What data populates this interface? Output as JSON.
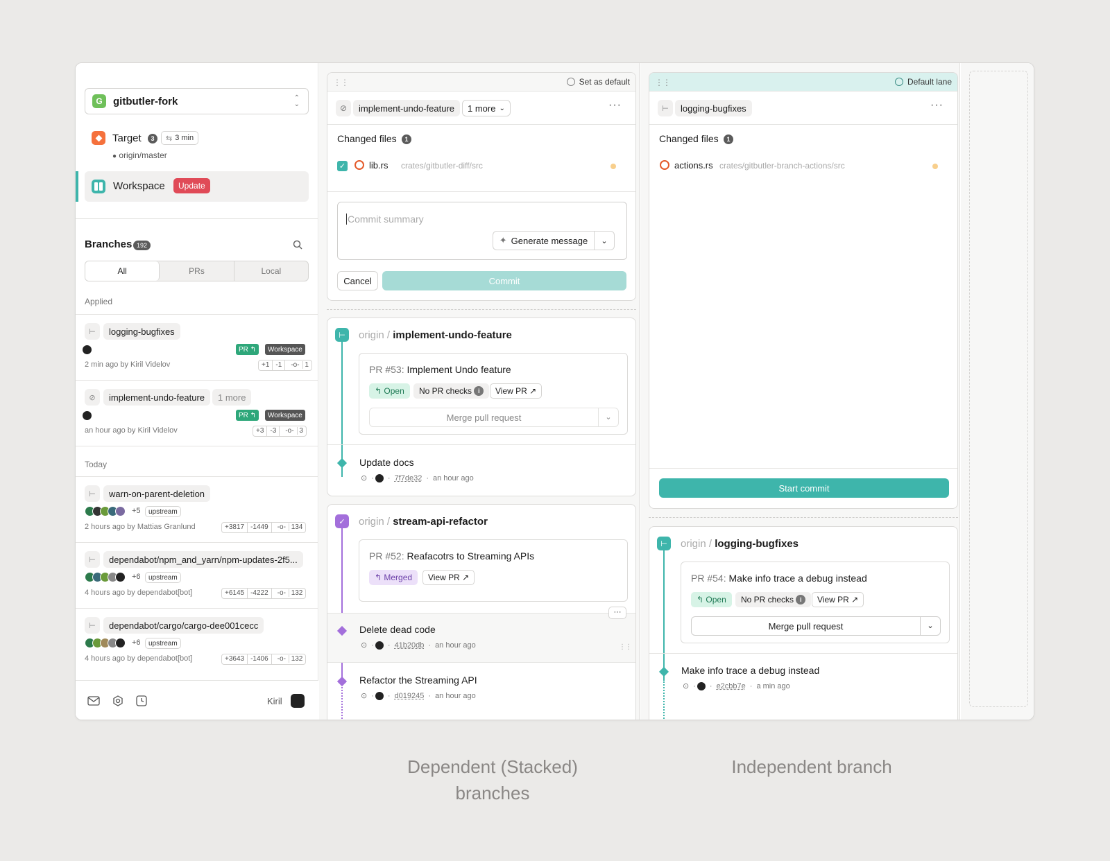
{
  "sidebar": {
    "project": {
      "initial": "G",
      "name": "gitbutler-fork"
    },
    "target": {
      "label": "Target",
      "count": "3",
      "sync_time": "3 min",
      "remote": "origin/master"
    },
    "workspace": {
      "label": "Workspace",
      "update_label": "Update"
    },
    "branches": {
      "title": "Branches",
      "count": "192",
      "tabs": [
        "All",
        "PRs",
        "Local"
      ],
      "active_tab": "All",
      "applied_label": "Applied",
      "today_label": "Today",
      "applied": [
        {
          "name": "logging-bugfixes",
          "pr": "PR",
          "workspace": "Workspace",
          "time": "2 min ago by Kiril Videlov",
          "add": "+1",
          "del": "-1",
          "commits": "1"
        },
        {
          "name": "implement-undo-feature",
          "more": "1 more",
          "pr": "PR",
          "workspace": "Workspace",
          "time": "an hour ago by Kiril Videlov",
          "add": "+3",
          "del": "-3",
          "commits": "3"
        }
      ],
      "today": [
        {
          "name": "warn-on-parent-deletion",
          "extra": "+5",
          "upstream": "upstream",
          "time": "2 hours ago by Mattias Granlund",
          "add": "+3817",
          "del": "-1449",
          "commits": "134"
        },
        {
          "name": "dependabot/npm_and_yarn/npm-updates-2f5...",
          "extra": "+6",
          "upstream": "upstream",
          "time": "4 hours ago by dependabot[bot]",
          "add": "+6145",
          "del": "-4222",
          "commits": "132"
        },
        {
          "name": "dependabot/cargo/cargo-dee001cecc",
          "extra": "+6",
          "upstream": "upstream",
          "time": "4 hours ago by dependabot[bot]",
          "add": "+3643",
          "del": "-1406",
          "commits": "132"
        }
      ]
    },
    "footer": {
      "user": "Kiril",
      "icons": [
        "mail-icon",
        "settings-icon",
        "history-icon"
      ]
    }
  },
  "lane1": {
    "set_default": "Set as default",
    "branch": "implement-undo-feature",
    "more": "1 more",
    "changed_files": "Changed files",
    "changed_count": "1",
    "file": {
      "name": "lib.rs",
      "path": "crates/gitbutler-diff/src"
    },
    "commit_placeholder": "Commit summary",
    "generate": "Generate message",
    "cancel": "Cancel",
    "commit": "Commit",
    "stack": [
      {
        "remote": "origin /",
        "name": "implement-undo-feature",
        "pr_num": "PR #53:",
        "pr_title": "Implement Undo feature",
        "status": "Open",
        "checks": "No PR checks",
        "view": "View PR",
        "merge": "Merge pull request",
        "commits": [
          {
            "title": "Update docs",
            "hash": "7f7de32",
            "time": "an hour ago"
          }
        ]
      },
      {
        "remote": "origin /",
        "name": "stream-api-refactor",
        "pr_num": "PR #52:",
        "pr_title": "Reafacotrs to Streaming APIs",
        "status": "Merged",
        "view": "View PR",
        "commits": [
          {
            "title": "Delete dead code",
            "hash": "41b20db",
            "time": "an hour ago"
          },
          {
            "title": "Refactor the Streaming API",
            "hash": "d019245",
            "time": "an hour ago"
          }
        ]
      }
    ]
  },
  "lane2": {
    "default_lane": "Default lane",
    "branch": "logging-bugfixes",
    "changed_files": "Changed files",
    "changed_count": "1",
    "file": {
      "name": "actions.rs",
      "path": "crates/gitbutler-branch-actions/src"
    },
    "start_commit": "Start commit",
    "remote": "origin /",
    "name": "logging-bugfixes",
    "pr_num": "PR #54:",
    "pr_title": "Make info trace a debug instead",
    "status": "Open",
    "checks": "No PR checks",
    "view": "View PR",
    "merge": "Merge pull request",
    "commit": {
      "title": "Make info trace a debug instead",
      "hash": "e2cbb7e",
      "time": "a min ago"
    }
  },
  "captions": {
    "stacked": [
      "Dependent (Stacked)",
      "branches"
    ],
    "independent": "Independent branch"
  },
  "colors": {
    "teal": "#3eb5ab",
    "purple": "#a36fdb",
    "red": "#e04a57",
    "orange": "#f5713c"
  }
}
